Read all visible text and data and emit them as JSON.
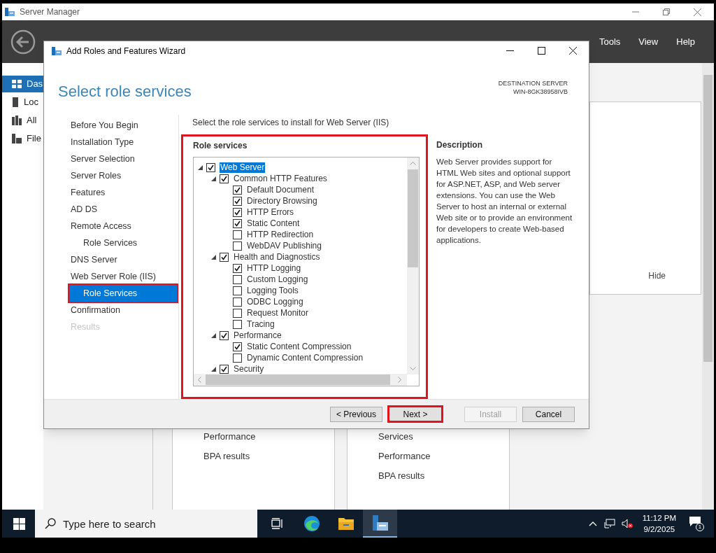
{
  "server_manager": {
    "title": "Server Manager",
    "menu": [
      "Tools",
      "View",
      "Help"
    ],
    "sidebar_items": [
      {
        "label": "Das",
        "selected": true
      },
      {
        "label": "Loc",
        "selected": false
      },
      {
        "label": "All",
        "selected": false
      },
      {
        "label": "File",
        "selected": false
      }
    ],
    "hide_link": "Hide",
    "tiles": [
      {
        "items": [
          "Performance",
          "BPA results"
        ]
      },
      {
        "items": [
          "Services",
          "Performance",
          "BPA results"
        ]
      }
    ]
  },
  "wizard": {
    "title": "Add Roles and Features Wizard",
    "page_title": "Select role services",
    "destination_label": "DESTINATION SERVER",
    "destination_server": "WIN-8GK38958IVB",
    "steps": [
      {
        "label": "Before You Begin",
        "selected": false,
        "disabled": false,
        "highlighted": false
      },
      {
        "label": "Installation Type",
        "selected": false,
        "disabled": false,
        "highlighted": false
      },
      {
        "label": "Server Selection",
        "selected": false,
        "disabled": false,
        "highlighted": false
      },
      {
        "label": "Server Roles",
        "selected": false,
        "disabled": false,
        "highlighted": false
      },
      {
        "label": "Features",
        "selected": false,
        "disabled": false,
        "highlighted": false
      },
      {
        "label": "AD DS",
        "selected": false,
        "disabled": false,
        "highlighted": false
      },
      {
        "label": "Remote Access",
        "selected": false,
        "disabled": false,
        "highlighted": false,
        "children": [
          {
            "label": "Role Services",
            "selected": false,
            "disabled": false,
            "highlighted": false
          }
        ]
      },
      {
        "label": "DNS Server",
        "selected": false,
        "disabled": false,
        "highlighted": false
      },
      {
        "label": "Web Server Role (IIS)",
        "selected": false,
        "disabled": false,
        "highlighted": false,
        "children": [
          {
            "label": "Role Services",
            "selected": true,
            "disabled": false,
            "highlighted": true
          }
        ]
      },
      {
        "label": "Confirmation",
        "selected": false,
        "disabled": false,
        "highlighted": false
      },
      {
        "label": "Results",
        "selected": false,
        "disabled": true,
        "highlighted": false
      }
    ],
    "instruction": "Select the role services to install for Web Server (IIS)",
    "role_services": {
      "heading": "Role services",
      "highlighted": true,
      "tree": [
        {
          "label": "Web Server",
          "checked": true,
          "expanded": true,
          "selected": true,
          "children": [
            {
              "label": "Common HTTP Features",
              "checked": true,
              "expanded": true,
              "selected": false,
              "children": [
                {
                  "label": "Default Document",
                  "checked": true,
                  "selected": false
                },
                {
                  "label": "Directory Browsing",
                  "checked": true,
                  "selected": false
                },
                {
                  "label": "HTTP Errors",
                  "checked": true,
                  "selected": false
                },
                {
                  "label": "Static Content",
                  "checked": true,
                  "selected": false
                },
                {
                  "label": "HTTP Redirection",
                  "checked": false,
                  "selected": false
                },
                {
                  "label": "WebDAV Publishing",
                  "checked": false,
                  "selected": false
                }
              ]
            },
            {
              "label": "Health and Diagnostics",
              "checked": true,
              "expanded": true,
              "selected": false,
              "children": [
                {
                  "label": "HTTP Logging",
                  "checked": true,
                  "selected": false
                },
                {
                  "label": "Custom Logging",
                  "checked": false,
                  "selected": false
                },
                {
                  "label": "Logging Tools",
                  "checked": false,
                  "selected": false
                },
                {
                  "label": "ODBC Logging",
                  "checked": false,
                  "selected": false
                },
                {
                  "label": "Request Monitor",
                  "checked": false,
                  "selected": false
                },
                {
                  "label": "Tracing",
                  "checked": false,
                  "selected": false
                }
              ]
            },
            {
              "label": "Performance",
              "checked": true,
              "expanded": true,
              "selected": false,
              "children": [
                {
                  "label": "Static Content Compression",
                  "checked": true,
                  "selected": false
                },
                {
                  "label": "Dynamic Content Compression",
                  "checked": false,
                  "selected": false
                }
              ]
            },
            {
              "label": "Security",
              "checked": true,
              "expanded": true,
              "selected": false
            }
          ]
        }
      ]
    },
    "description": {
      "heading": "Description",
      "text": "Web Server provides support for HTML Web sites and optional support for ASP.NET, ASP, and Web server extensions. You can use the Web Server to host an internal or external Web site or to provide an environment for developers to create Web-based applications."
    },
    "buttons": [
      {
        "label": "< Previous",
        "disabled": false,
        "highlighted": false
      },
      {
        "label": "Next >",
        "disabled": false,
        "highlighted": true
      },
      {
        "label": "Install",
        "disabled": true,
        "highlighted": false
      },
      {
        "label": "Cancel",
        "disabled": false,
        "highlighted": false
      }
    ]
  },
  "taskbar": {
    "search_placeholder": "Type here to search",
    "apps": [
      {
        "kind": "task-view",
        "active": false
      },
      {
        "kind": "browser",
        "active": false
      },
      {
        "kind": "folder",
        "active": false
      },
      {
        "kind": "server-manager",
        "active": true
      }
    ],
    "time": "11:12 PM",
    "date": "9/2/2025",
    "notification_count": "1"
  }
}
